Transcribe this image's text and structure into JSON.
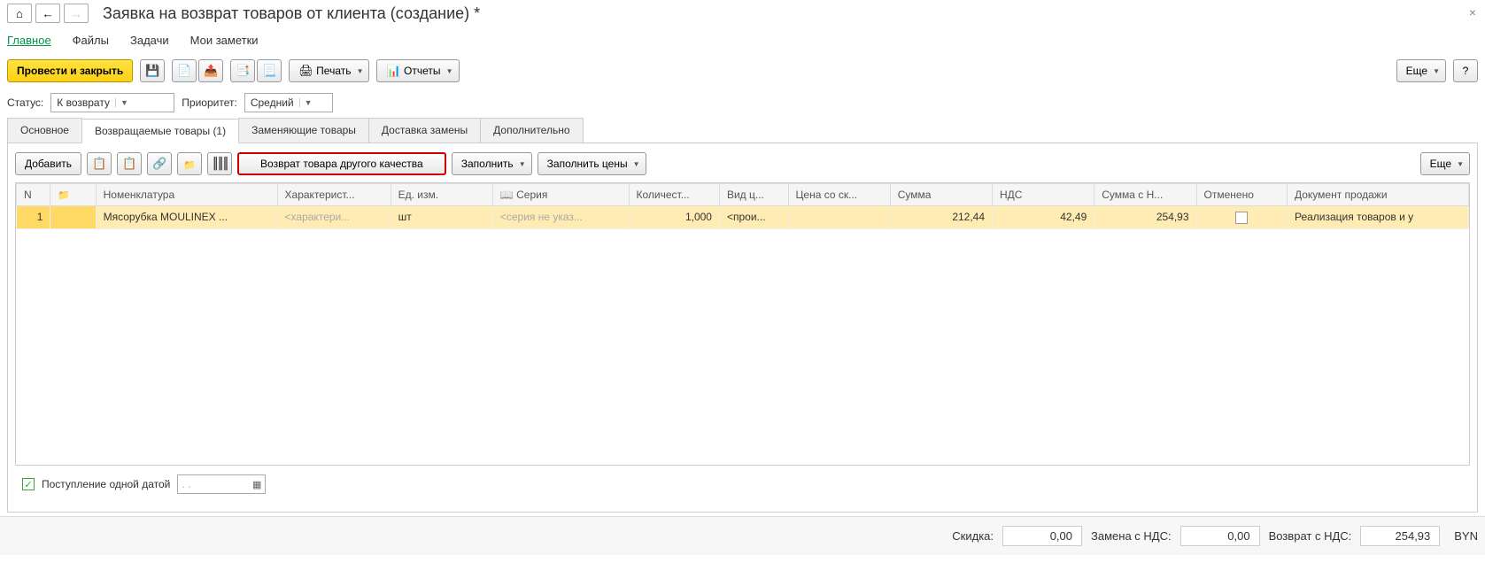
{
  "window": {
    "title": "Заявка на возврат товаров от клиента (создание) *"
  },
  "nav_tabs": {
    "items": [
      "Главное",
      "Файлы",
      "Задачи",
      "Мои заметки"
    ],
    "active": 0
  },
  "toolbar": {
    "primary": "Провести и закрыть",
    "print": "Печать",
    "reports": "Отчеты",
    "more": "Еще",
    "help": "?"
  },
  "status": {
    "status_label": "Статус:",
    "status_value": "К возврату",
    "priority_label": "Приоритет:",
    "priority_value": "Средний"
  },
  "page_tabs": {
    "items": [
      "Основное",
      "Возвращаемые товары (1)",
      "Заменяющие товары",
      "Доставка замены",
      "Дополнительно"
    ],
    "active": 1
  },
  "inner_toolbar": {
    "add": "Добавить",
    "return_quality": "Возврат товара другого качества",
    "fill": "Заполнить",
    "fill_prices": "Заполнить цены",
    "more": "Еще"
  },
  "table": {
    "headers": [
      "N",
      "",
      "Номенклатура",
      "Характерист...",
      "Ед. изм.",
      "Серия",
      "Количест...",
      "Вид ц...",
      "Цена со ск...",
      "Сумма",
      "НДС",
      "Сумма с Н...",
      "Отменено",
      "Документ продажи"
    ],
    "rows": [
      {
        "n": "1",
        "folder": "",
        "nomenclature": "Мясорубка MOULINEX ...",
        "characteristic": "<характери...",
        "unit": "шт",
        "series": "<серия не указ...",
        "qty": "1,000",
        "price_type": "<прои...",
        "price_disc": "",
        "sum": "212,44",
        "vat": "42,49",
        "sum_vat": "254,93",
        "cancelled": false,
        "sale_doc": "Реализация товаров и у"
      }
    ]
  },
  "footer": {
    "single_date_label": "Поступление одной датой",
    "date_value": " . .",
    "discount_label": "Скидка:",
    "discount_value": "0,00",
    "replace_vat_label": "Замена с НДС:",
    "replace_vat_value": "0,00",
    "return_vat_label": "Возврат с НДС:",
    "return_vat_value": "254,93",
    "currency": "BYN"
  }
}
